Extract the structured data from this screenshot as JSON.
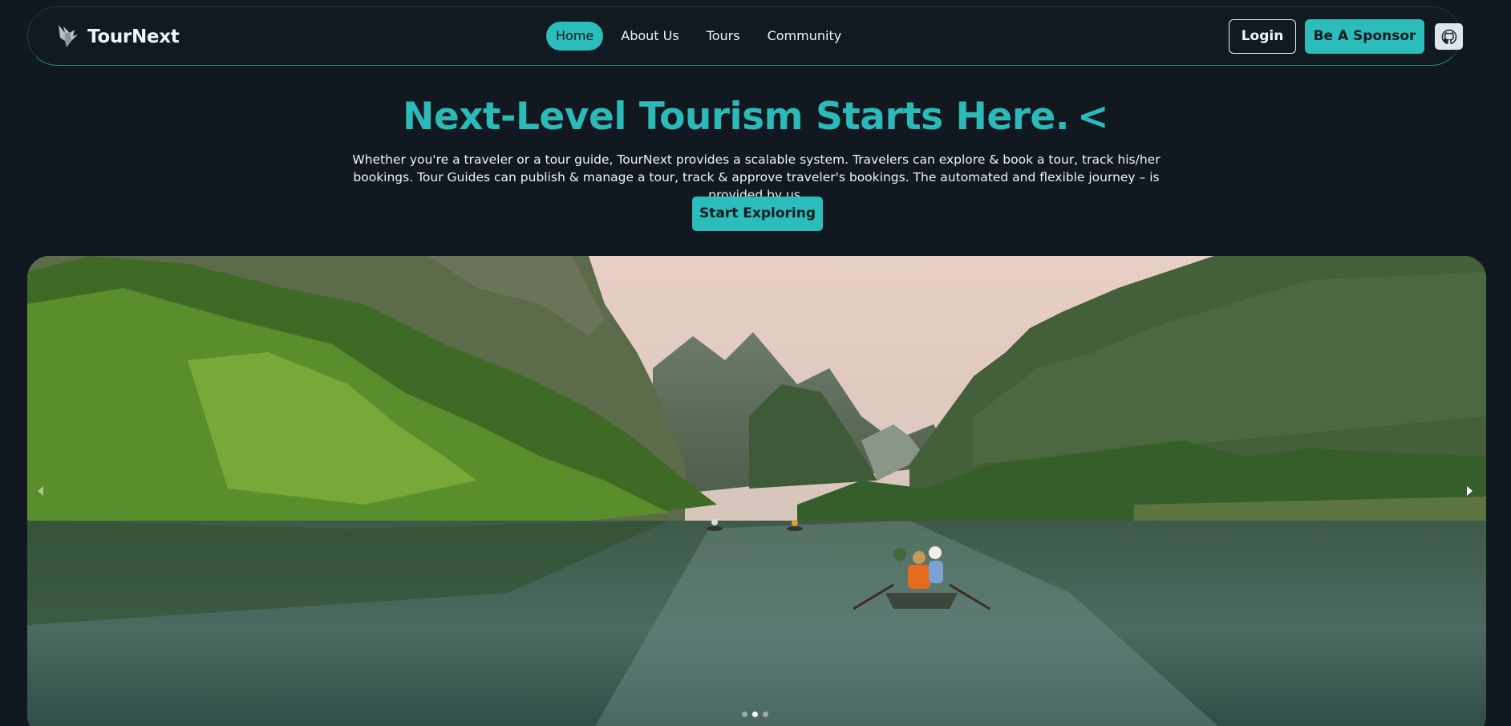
{
  "brand": {
    "name": "TourNext",
    "logo_icon": "bird-logo-icon"
  },
  "nav": {
    "links": [
      {
        "label": "Home",
        "active": true
      },
      {
        "label": "About Us",
        "active": false
      },
      {
        "label": "Tours",
        "active": false
      },
      {
        "label": "Community",
        "active": false
      }
    ],
    "login_label": "Login",
    "sponsor_label": "Be A Sponsor",
    "github_icon": "github-icon"
  },
  "hero": {
    "title": "Next-Level Tourism Starts Here.",
    "cursor": "<",
    "description": "Whether you're a traveler or a tour guide, TourNext provides a scalable system. Travelers can explore & book a tour, track his/her bookings. Tour Guides can publish & manage a tour, track & approve traveler's bookings. The automated and flexible journey – is provided by us.",
    "cta_label": "Start Exploring"
  },
  "carousel": {
    "prev_icon": "chevron-left-icon",
    "next_icon": "chevron-right-icon",
    "active_slide": 2,
    "slide_count": 3
  },
  "colors": {
    "accent": "#2bbdbb",
    "background": "#111820"
  }
}
